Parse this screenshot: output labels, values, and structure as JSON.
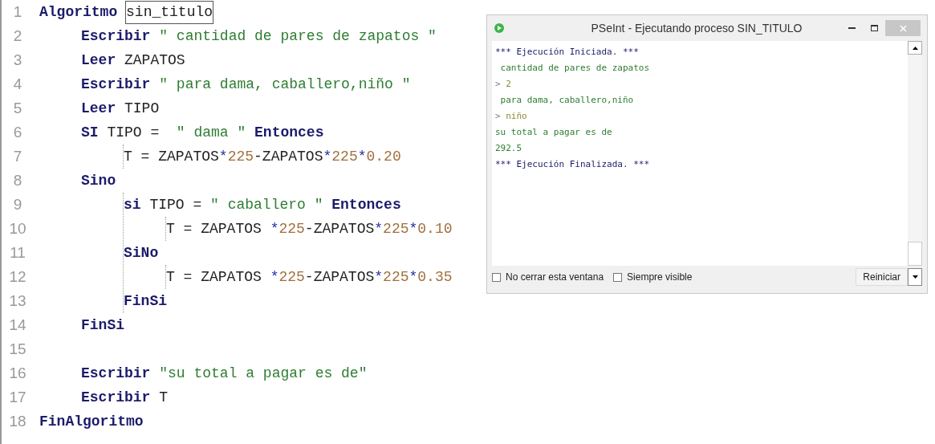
{
  "editor": {
    "lines": [
      {
        "number": "1",
        "tokens": [
          {
            "kind": "keyword",
            "text": "Algoritmo "
          },
          {
            "kind": "plain",
            "text": "sin_titulo",
            "outlined": true
          }
        ],
        "children": [
          {
            "number": "2",
            "tokens": [
              {
                "kind": "keyword",
                "text": "Escribir"
              },
              {
                "kind": "string",
                "text": " \" cantidad de pares de zapatos \""
              }
            ]
          },
          {
            "number": "3",
            "tokens": [
              {
                "kind": "keyword",
                "text": "Leer"
              },
              {
                "kind": "plain",
                "text": " ZAPATOS"
              }
            ]
          },
          {
            "number": "4",
            "tokens": [
              {
                "kind": "keyword",
                "text": "Escribir"
              },
              {
                "kind": "string",
                "text": " \" para dama, caballero,niño \""
              }
            ]
          },
          {
            "number": "5",
            "tokens": [
              {
                "kind": "keyword",
                "text": "Leer"
              },
              {
                "kind": "plain",
                "text": " TIPO"
              }
            ]
          },
          {
            "number": "6",
            "tokens": [
              {
                "kind": "keyword",
                "text": "SI"
              },
              {
                "kind": "plain",
                "text": " TIPO =  "
              },
              {
                "kind": "string",
                "text": "\" dama \" "
              },
              {
                "kind": "keyword",
                "text": "Entonces"
              }
            ],
            "children": [
              {
                "number": "7",
                "tokens": [
                  {
                    "kind": "plain",
                    "text": "T = ZAPATOS"
                  },
                  {
                    "kind": "operator",
                    "text": "*"
                  },
                  {
                    "kind": "number",
                    "text": "225"
                  },
                  {
                    "kind": "plain",
                    "text": "-ZAPATOS"
                  },
                  {
                    "kind": "operator",
                    "text": "*"
                  },
                  {
                    "kind": "number",
                    "text": "225"
                  },
                  {
                    "kind": "operator",
                    "text": "*"
                  },
                  {
                    "kind": "number",
                    "text": "0.20"
                  }
                ]
              }
            ]
          },
          {
            "number": "8",
            "tokens": [
              {
                "kind": "keyword",
                "text": "Sino"
              }
            ],
            "children": [
              {
                "number": "9",
                "tokens": [
                  {
                    "kind": "keyword",
                    "text": "si"
                  },
                  {
                    "kind": "plain",
                    "text": " TIPO = "
                  },
                  {
                    "kind": "string",
                    "text": "\" caballero \" "
                  },
                  {
                    "kind": "keyword",
                    "text": "Entonces"
                  }
                ],
                "children": [
                  {
                    "number": "10",
                    "tokens": [
                      {
                        "kind": "plain",
                        "text": "T = ZAPATOS "
                      },
                      {
                        "kind": "operator",
                        "text": "*"
                      },
                      {
                        "kind": "number",
                        "text": "225"
                      },
                      {
                        "kind": "plain",
                        "text": "-ZAPATOS"
                      },
                      {
                        "kind": "operator",
                        "text": "*"
                      },
                      {
                        "kind": "number",
                        "text": "225"
                      },
                      {
                        "kind": "operator",
                        "text": "*"
                      },
                      {
                        "kind": "number",
                        "text": "0.10"
                      }
                    ]
                  }
                ]
              },
              {
                "number": "11",
                "tokens": [
                  {
                    "kind": "keyword",
                    "text": "SiNo"
                  }
                ],
                "children": [
                  {
                    "number": "12",
                    "tokens": [
                      {
                        "kind": "plain",
                        "text": "T = ZAPATOS "
                      },
                      {
                        "kind": "operator",
                        "text": "*"
                      },
                      {
                        "kind": "number",
                        "text": "225"
                      },
                      {
                        "kind": "plain",
                        "text": "-ZAPATOS"
                      },
                      {
                        "kind": "operator",
                        "text": "*"
                      },
                      {
                        "kind": "number",
                        "text": "225"
                      },
                      {
                        "kind": "operator",
                        "text": "*"
                      },
                      {
                        "kind": "number",
                        "text": "0.35"
                      }
                    ]
                  }
                ]
              },
              {
                "number": "13",
                "tokens": [
                  {
                    "kind": "keyword",
                    "text": "FinSi"
                  }
                ]
              }
            ]
          },
          {
            "number": "14",
            "tokens": [
              {
                "kind": "keyword",
                "text": "FinSi"
              }
            ]
          },
          {
            "number": "15"
          },
          {
            "number": "16",
            "tokens": [
              {
                "kind": "keyword",
                "text": "Escribir"
              },
              {
                "kind": "string",
                "text": " \"su total a pagar es de\""
              }
            ]
          },
          {
            "number": "17",
            "tokens": [
              {
                "kind": "keyword",
                "text": "Escribir"
              },
              {
                "kind": "plain",
                "text": " T"
              }
            ]
          }
        ]
      },
      {
        "number": "18",
        "tokens": [
          {
            "kind": "keyword",
            "text": "FinAlgoritmo"
          }
        ]
      }
    ]
  },
  "console_window": {
    "title": "PSeInt - Ejecutando proceso SIN_TITULO",
    "lines": [
      {
        "kind": "info",
        "text": "*** Ejecución Iniciada. ***"
      },
      {
        "kind": "output",
        "text": " cantidad de pares de zapatos"
      },
      {
        "kind": "input",
        "prompt": ">",
        "text": "2"
      },
      {
        "kind": "output",
        "text": " para dama, caballero,niño"
      },
      {
        "kind": "input",
        "prompt": ">",
        "text": "niño"
      },
      {
        "kind": "output",
        "text": "su total a pagar es de"
      },
      {
        "kind": "output",
        "text": "292.5"
      },
      {
        "kind": "info",
        "text": "*** Ejecución Finalizada. ***"
      }
    ],
    "options": [
      {
        "label": "No cerrar esta ventana",
        "checked": false
      },
      {
        "label": "Siempre visible",
        "checked": false
      }
    ],
    "restart_button": "Reiniciar"
  }
}
